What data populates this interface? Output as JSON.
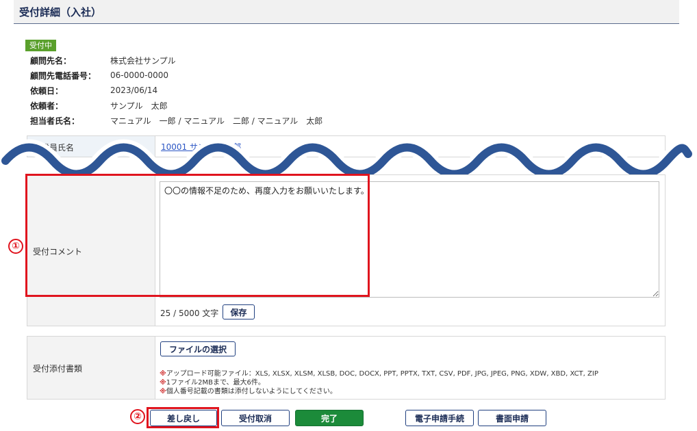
{
  "header": {
    "title": "受付詳細（入社）"
  },
  "status_badge": "受付中",
  "info": [
    {
      "label": "顧問先名：",
      "value": "株式会社サンプル"
    },
    {
      "label": "顧問先電話番号：",
      "value": "06-0000-0000"
    },
    {
      "label": "依頼日：",
      "value": "2023/06/14"
    },
    {
      "label": "依頼者：",
      "value": "サンプル　太郎"
    },
    {
      "label": "担当者氏名：",
      "value": "マニュアル　一郎 / マニュアル　二郎 / マニュアル　太郎"
    }
  ],
  "employee_row": {
    "label": "従業員氏名",
    "link_text": "10001 サンプル 一郎"
  },
  "comment": {
    "label": "受付コメント",
    "value": "〇〇の情報不足のため、再度入力をお願いいたします。",
    "counter": "25 / 5000 文字",
    "save_label": "保存"
  },
  "attachments": {
    "label": "受付添付書類",
    "select_label": "ファイルの選択",
    "note_mark": "※",
    "notes": [
      "アップロード可能ファイル：XLS, XLSX, XLSM, XLSB, DOC, DOCX, PPT, PPTX, TXT, CSV, PDF, JPG, JPEG, PNG, XDW, XBD, XCT, ZIP",
      "1ファイル2MBまで、最大6件。",
      "個人番号記載の書類は添付しないようにしてください。"
    ]
  },
  "actions": {
    "return_label": "差し戻し",
    "cancel_label": "受付取消",
    "complete_label": "完了",
    "electronic_label": "電子申請手続",
    "paper_label": "書面申請"
  },
  "annotations": {
    "marker_1": "①",
    "marker_2": "②"
  },
  "colors": {
    "status": "#5aa02c",
    "complete": "#1c8b3a",
    "highlight": "#e0141e",
    "wave": "#2e5696"
  }
}
